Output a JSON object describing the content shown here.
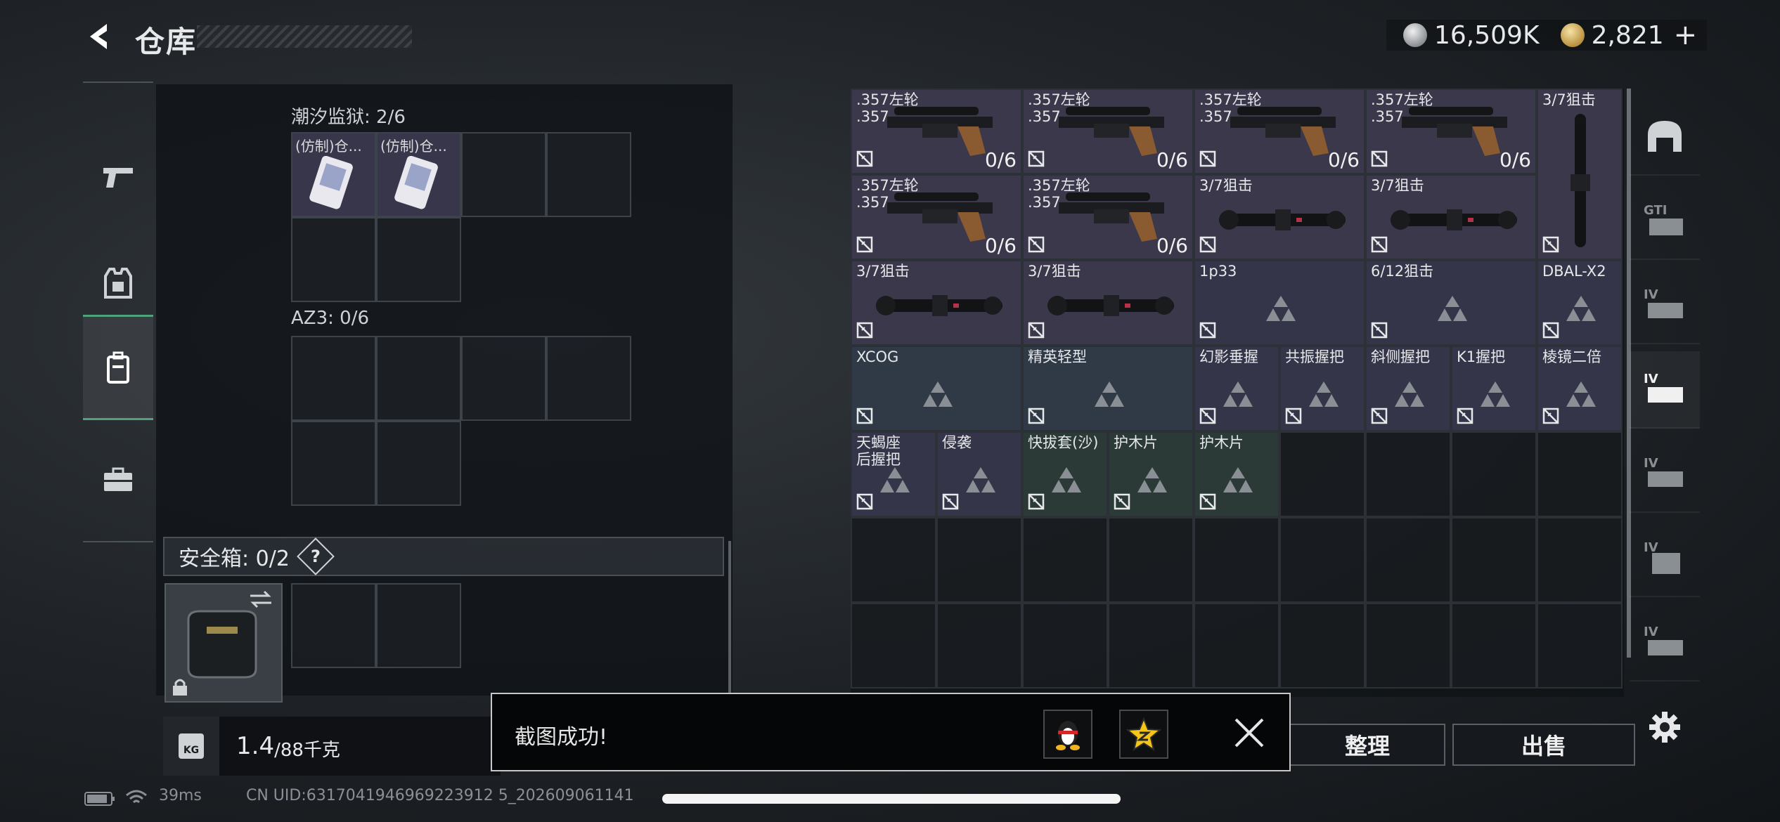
{
  "header": {
    "title": "仓库",
    "back_icon": "back-arrow-icon"
  },
  "currency": {
    "silver_amount": "16,509K",
    "gold_amount": "2,821",
    "add_label": "+"
  },
  "left_nav": [
    {
      "icon": "pistol-icon",
      "active": false
    },
    {
      "icon": "armor-vest-icon",
      "active": false
    },
    {
      "icon": "backpack-icon",
      "active": true
    },
    {
      "icon": "toolbox-icon",
      "active": false
    }
  ],
  "containers": {
    "tide_prison": {
      "label": "潮汐监狱: 2/6",
      "items": [
        "(仿制)仓...",
        "(仿制)仓..."
      ]
    },
    "az3": {
      "label": "AZ3: 0/6"
    },
    "safe_box": {
      "label": "安全箱:  0/2",
      "help": "?"
    }
  },
  "weight": {
    "value": "1.4",
    "capacity": "/88千克",
    "icon_label": "KG"
  },
  "stash_items": [
    {
      "name": ".357左轮\n.357",
      "count": "0/6"
    },
    {
      "name": ".357左轮\n.357",
      "count": "0/6"
    },
    {
      "name": ".357左轮\n.357",
      "count": "0/6"
    },
    {
      "name": ".357左轮\n.357",
      "count": "0/6"
    },
    {
      "name": "3/7狙击"
    },
    {
      "name": ".357左轮\n.357",
      "count": "0/6"
    },
    {
      "name": ".357左轮\n.357",
      "count": "0/6"
    },
    {
      "name": "3/7狙击"
    },
    {
      "name": "3/7狙击"
    },
    {
      "name": "3/7狙击"
    },
    {
      "name": "3/7狙击"
    },
    {
      "name": "1p33"
    },
    {
      "name": "6/12狙击"
    },
    {
      "name": "DBAL-X2"
    },
    {
      "name": "XCOG"
    },
    {
      "name": "精英轻型"
    },
    {
      "name": "幻影垂握"
    },
    {
      "name": "共振握把"
    },
    {
      "name": "斜侧握把"
    },
    {
      "name": "K1握把"
    },
    {
      "name": "棱镜二倍"
    },
    {
      "name": "天蝎座\n后握把"
    },
    {
      "name": "侵袭"
    },
    {
      "name": "快拔套(沙)"
    },
    {
      "name": "护木片"
    },
    {
      "name": "护木片"
    }
  ],
  "right_nav": [
    {
      "icon": "helmet-icon",
      "text": ""
    },
    {
      "icon": "gt-bag-icon",
      "text": "GTI"
    },
    {
      "icon": "tier4-bag-icon",
      "text": "IV"
    },
    {
      "icon": "tier4-bag-icon",
      "text": "IV"
    },
    {
      "icon": "tier4-bag-icon",
      "text": "IV"
    },
    {
      "icon": "tier4-case-icon",
      "text": "IV"
    },
    {
      "icon": "tier4-case-icon",
      "text": "IV"
    }
  ],
  "actions": {
    "sort_label": "整理",
    "sell_label": "出售",
    "settings_icon": "gear-icon"
  },
  "toast": {
    "message": "截图成功!",
    "share_qq_icon": "qq-penguin-icon",
    "share_qzone_icon": "qzone-star-icon",
    "close_icon": "close-icon"
  },
  "status": {
    "ping": "39ms",
    "uid": "CN UID:6317041946969223912 5_202609061141"
  }
}
